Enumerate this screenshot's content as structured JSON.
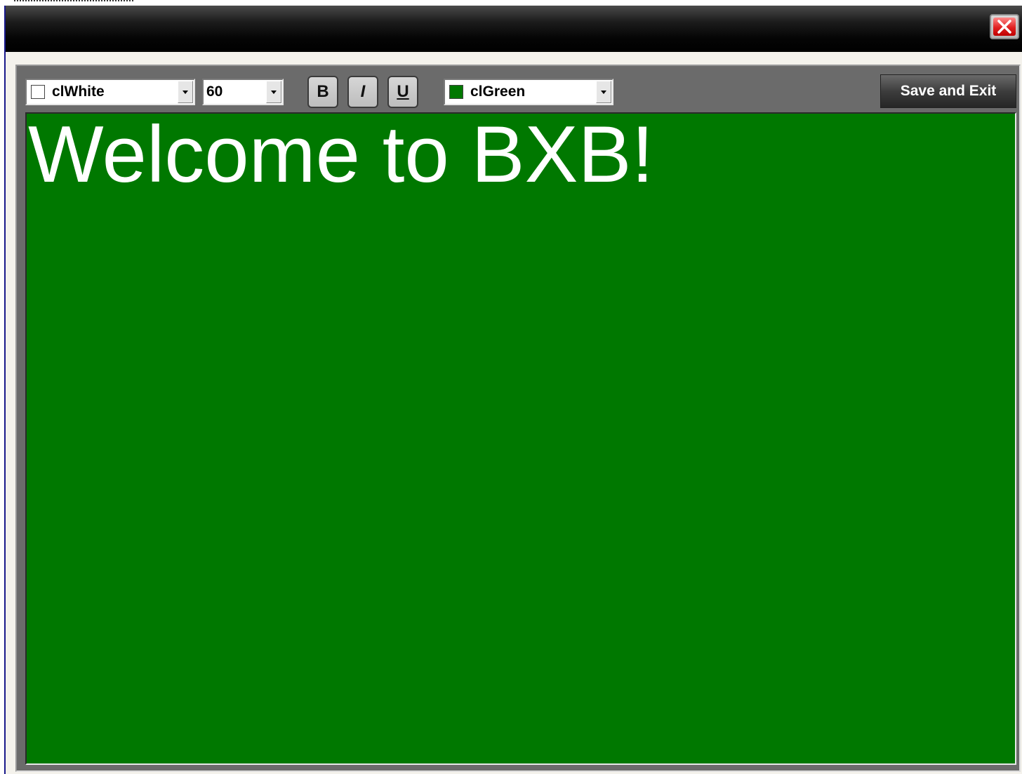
{
  "window": {
    "close_icon": "close-x-icon",
    "close_color": "#d81818"
  },
  "toolbar": {
    "font_color": {
      "value": "clWhite",
      "swatch": "#ffffff"
    },
    "font_size": {
      "value": "60"
    },
    "bold_label": "B",
    "italic_label": "I",
    "underline_label": "U",
    "background_color": {
      "value": "clGreen",
      "swatch": "#007800"
    },
    "save_label": "Save and Exit"
  },
  "editor": {
    "text": "Welcome to BXB!",
    "text_color": "#ffffff",
    "background": "#007800"
  }
}
